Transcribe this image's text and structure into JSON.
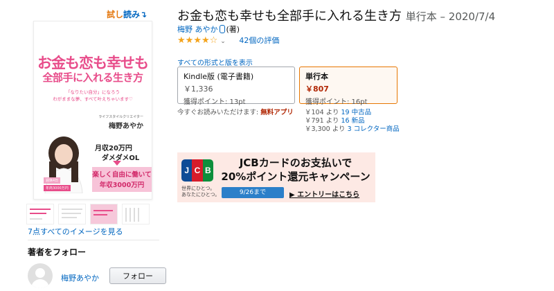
{
  "look_inside": {
    "part1": "試し",
    "part2": "読み",
    "arrow": "↴"
  },
  "cover": {
    "title_line1": "お金も恋も幸せも",
    "title_line2": "全部手に入れる生き方",
    "sub_line1": "「なりたい自分」になろう",
    "sub_line2": "わがままな夢、すべて叶えちゃいます♡",
    "author_label": "ライフスタイルクリエイター",
    "author": "梅野あやか",
    "salary": "月収20万円",
    "ol": "ダメダメOL",
    "banner_line1": "楽しく自由に働いて",
    "banner_line2": "年収3000万円",
    "tag1": "週休4日",
    "tag2": "年商3000万円"
  },
  "images_link": "7点すべてのイメージを見る",
  "follow": {
    "heading": "著者をフォロー",
    "author": "梅野あやか",
    "button": "フォロー"
  },
  "product": {
    "title": "お金も恋も幸せも全部手に入れる生き方",
    "format_date": "単行本 – 2020/7/4",
    "author": "梅野 あやか",
    "role": "(著)",
    "rating": 4,
    "rating_max": 5,
    "rating_count": "42個の評価"
  },
  "formats": {
    "all_link": "すべての形式と版を表示",
    "kindle": {
      "name": "Kindle版 (電子書籍)",
      "price": "￥1,336",
      "points": "獲得ポイント: 13pt"
    },
    "tankobon": {
      "name": "単行本",
      "price": "￥807",
      "points": "獲得ポイント: 16pt"
    },
    "kindle_note": "今すぐお読みいただけます:",
    "free_app": "無料アプリ",
    "offers": [
      {
        "price": "￥104",
        "from": "より",
        "link": "19 中古品"
      },
      {
        "price": "￥791",
        "from": "より",
        "link": "16 新品"
      },
      {
        "price": "￥3,300",
        "from": "より",
        "link": "3 コレクター商品"
      }
    ]
  },
  "jcb": {
    "logo": [
      "J",
      "C",
      "B"
    ],
    "head1": "JCBカードのお支払いで",
    "head2": "20%ポイント還元キャンペーン",
    "tagline1": "世界にひとつ。",
    "tagline2": "あなたにひとつ。",
    "date": "9/26まで",
    "entry": "▶ エントリーはこちら"
  },
  "colors": {
    "link": "#0066c0",
    "price_red": "#b12704",
    "star": "#f4a41d",
    "cover_pink": "#e84c8a",
    "selected_border": "#e77600"
  }
}
